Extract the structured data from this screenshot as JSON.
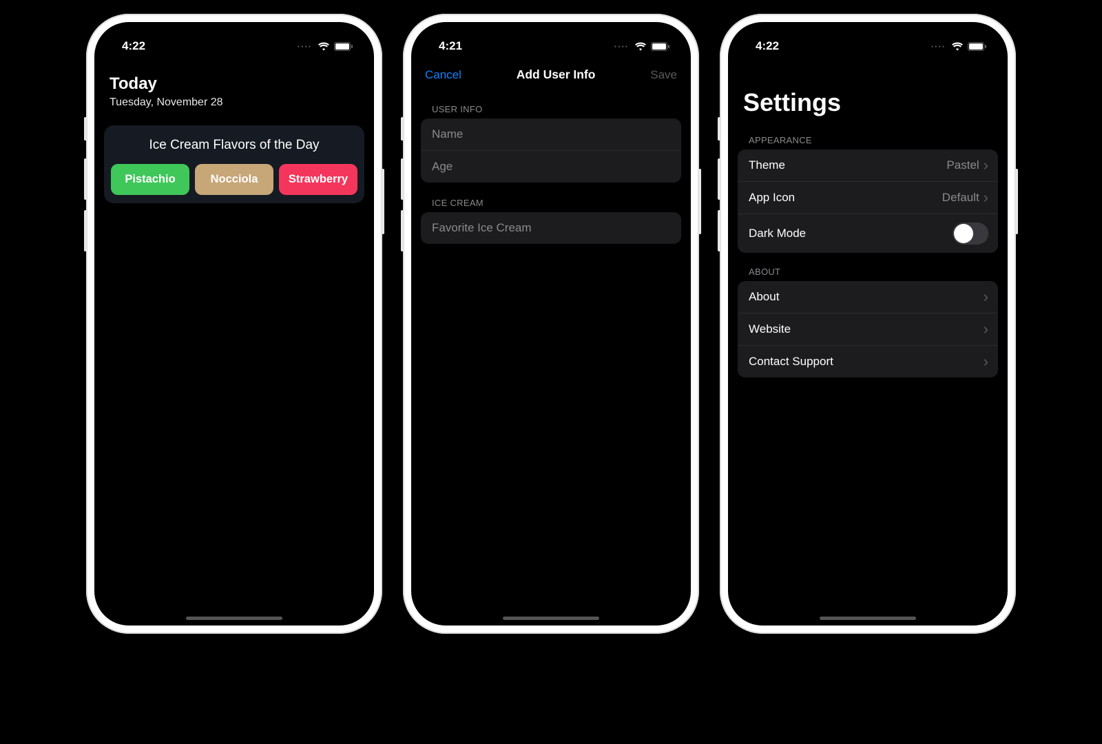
{
  "status": {
    "time1": "4:22",
    "time2": "4:21",
    "time3": "4:22"
  },
  "screen1": {
    "title": "Today",
    "date": "Tuesday, November 28",
    "card_title": "Ice Cream Flavors of the Day",
    "flavors": [
      {
        "name": "Pistachio",
        "color": "#3fc75a"
      },
      {
        "name": "Nocciola",
        "color": "#c7a678"
      },
      {
        "name": "Strawberry",
        "color": "#f5365c"
      }
    ]
  },
  "screen2": {
    "cancel": "Cancel",
    "title": "Add User Info",
    "save": "Save",
    "section1_label": "USER INFO",
    "name_placeholder": "Name",
    "age_placeholder": "Age",
    "section2_label": "ICE CREAM",
    "fav_placeholder": "Favorite Ice Cream"
  },
  "screen3": {
    "title": "Settings",
    "appearance_label": "APPEARANCE",
    "theme_label": "Theme",
    "theme_value": "Pastel",
    "appicon_label": "App Icon",
    "appicon_value": "Default",
    "darkmode_label": "Dark Mode",
    "about_label": "ABOUT",
    "about_row": "About",
    "website_row": "Website",
    "support_row": "Contact Support"
  }
}
